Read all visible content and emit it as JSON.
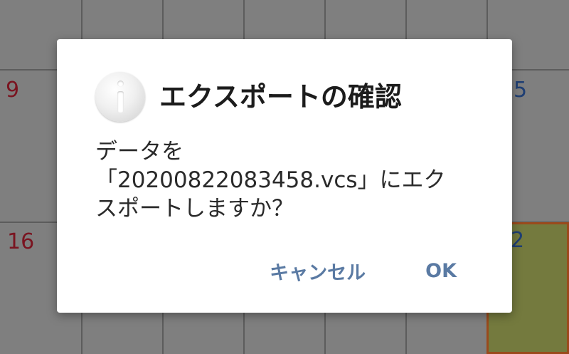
{
  "calendar": {
    "days": [
      {
        "label": "9",
        "tone": "red"
      },
      {
        "label": "5",
        "tone": "blue"
      },
      {
        "label": "16",
        "tone": "red"
      },
      {
        "label": "2",
        "tone": "blue"
      }
    ],
    "colors": {
      "background": "#7f7f7f",
      "grid_line": "#5c5c5c",
      "sunday": "#7a1420",
      "saturday": "#1f3f74",
      "today_fill": "#747a3e",
      "today_border": "#9a4a1c"
    }
  },
  "dialog": {
    "icon": "info-icon",
    "title": "エクスポートの確認",
    "message": "データを\n「20200822083458.vcs」にエク\nスポートしますか？",
    "buttons": {
      "cancel": "キャンセル",
      "ok": "OK"
    },
    "colors": {
      "button_text": "#5a7aa3",
      "background": "#ffffff"
    }
  }
}
